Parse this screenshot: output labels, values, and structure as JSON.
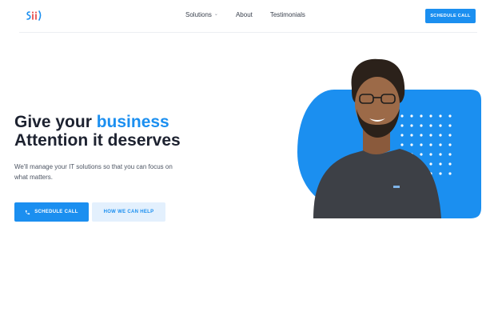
{
  "brand": {
    "logo_text": "Siil",
    "accent": "#1b8ff0"
  },
  "nav": {
    "items": [
      {
        "label": "Solutions",
        "has_dropdown": true
      },
      {
        "label": "About"
      },
      {
        "label": "Testimonials"
      }
    ]
  },
  "header": {
    "cta_label": "SCHEDULE CALL"
  },
  "hero": {
    "title_part1": "Give your ",
    "title_accent": "business",
    "title_line2": "Attention it deserves",
    "subtitle": "We'll manage your IT solutions so that you can focus on what matters.",
    "primary_button": "SCHEDULE CALL",
    "primary_icon": "phone-icon",
    "secondary_button": "HOW WE CAN HELP"
  },
  "colors": {
    "accent": "#1b8ff0",
    "accent_light": "#e3f0fd",
    "heading": "#1d2230",
    "body": "#4d5563"
  }
}
